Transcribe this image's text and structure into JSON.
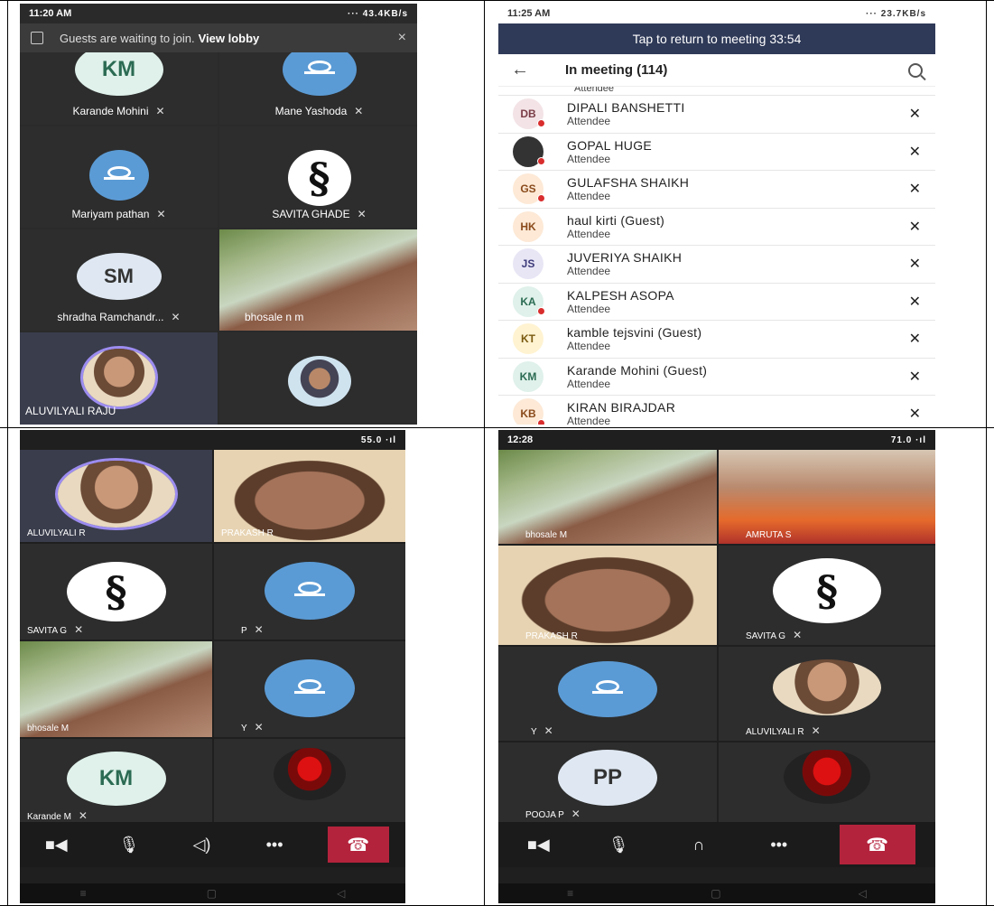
{
  "top_left": {
    "status_time": "11:20 AM",
    "status_icons": "··· 43.4KB/s",
    "banner_text": "Guests are waiting to join.",
    "banner_link": "View lobby",
    "close_icon": "×",
    "tiles": [
      {
        "name": "Karande Mohini",
        "initials": "KM"
      },
      {
        "name": "Mane Yashoda"
      },
      {
        "name": "Mariyam pathan"
      },
      {
        "name": "SAVITA GHADE",
        "logo": "§"
      },
      {
        "name": "shradha Ramchandr...",
        "initials": "SM"
      },
      {
        "name": "bhosale n m"
      },
      {
        "name": "ALUVILYALI RAJU"
      },
      {
        "name": ""
      }
    ]
  },
  "top_right": {
    "status_time": "11:25 AM",
    "status_icons": "··· 23.7KB/s",
    "tap_bar": "Tap to return to meeting 33:54",
    "back_icon": "←",
    "title": "In meeting (114)",
    "partial_role": "Attendee",
    "participants": [
      {
        "initials": "DB",
        "name": "DIPALI BANSHETTI",
        "role": "Attendee",
        "bg": "#f3e3e6",
        "fg": "#7a3d48",
        "dot": true
      },
      {
        "initials": "",
        "name": "GOPAL HUGE",
        "role": "Attendee",
        "bg": "#333333",
        "fg": "#ffffff",
        "dot": true
      },
      {
        "initials": "GS",
        "name": "GULAFSHA SHAIKH",
        "role": "Attendee",
        "bg": "#fde9d6",
        "fg": "#8a4b1c",
        "dot": true
      },
      {
        "initials": "HK",
        "name": "haul  kirti (Guest)",
        "role": "Attendee",
        "bg": "#fde9d6",
        "fg": "#8a4b1c",
        "dot": false
      },
      {
        "initials": "JS",
        "name": "JUVERIYA SHAIKH",
        "role": "Attendee",
        "bg": "#e8e6f5",
        "fg": "#3d3a7a",
        "dot": false
      },
      {
        "initials": "KA",
        "name": "KALPESH ASOPA",
        "role": "Attendee",
        "bg": "#dff1ea",
        "fg": "#2b6b53",
        "dot": true
      },
      {
        "initials": "KT",
        "name": "kamble tejsvini  (Guest)",
        "role": "Attendee",
        "bg": "#fff3d1",
        "fg": "#7a5a10",
        "dot": false
      },
      {
        "initials": "KM",
        "name": "Karande Mohini  (Guest)",
        "role": "Attendee",
        "bg": "#dff1ea",
        "fg": "#2b6b53",
        "dot": false
      },
      {
        "initials": "KB",
        "name": "KIRAN BIRAJDAR",
        "role": "Attendee",
        "bg": "#fde9d6",
        "fg": "#8a4b1c",
        "dot": true
      }
    ]
  },
  "bottom_left": {
    "status_icons": "55.0 ·ıl",
    "tiles": [
      {
        "name": "ALUVILYALI R"
      },
      {
        "name": "PRAKASH R"
      },
      {
        "name": "SAVITA G",
        "logo": "§"
      },
      {
        "name": "P"
      },
      {
        "name": "bhosale M"
      },
      {
        "name": "Y"
      },
      {
        "name": "Karande M",
        "initials": "KM"
      },
      {
        "name": ""
      }
    ]
  },
  "bottom_right": {
    "status_time": "12:28",
    "status_icons": "71.0 ·ıl",
    "tiles": [
      {
        "name": "bhosale M"
      },
      {
        "name": "AMRUTA S"
      },
      {
        "name": "PRAKASH R"
      },
      {
        "name": "SAVITA G",
        "logo": "§"
      },
      {
        "name": "Y"
      },
      {
        "name": "ALUVILYALI R"
      },
      {
        "name": "POOJA P",
        "initials": "PP"
      },
      {
        "name": ""
      }
    ]
  },
  "controls": {
    "camera_icon": "■◀",
    "mic_icon": "🎙",
    "speaker_icon": "◁)",
    "headset_icon": "∩",
    "more_icon": "•••",
    "hangup_icon": "☎"
  },
  "mic_muted_icon": "✕",
  "nav": {
    "menu": "≡",
    "home": "▢",
    "back": "◁"
  }
}
